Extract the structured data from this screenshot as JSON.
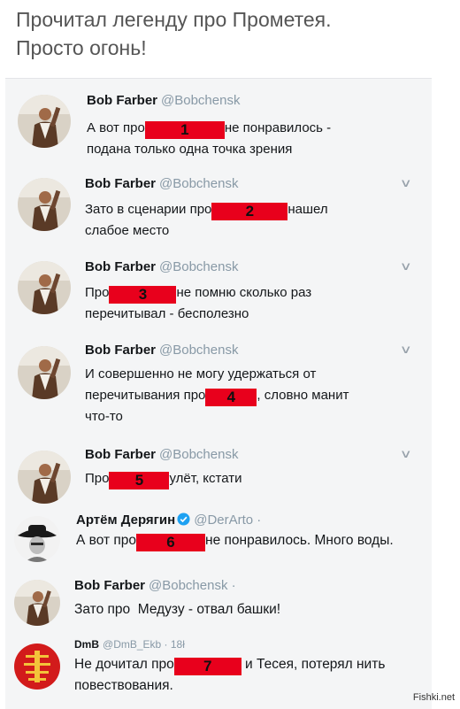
{
  "headline": {
    "line1": "Прочитал легенду про Прометея.",
    "line2": "Просто огонь!"
  },
  "tweets": [
    {
      "name": "Bob Farber",
      "handle": "@Bobchensk",
      "avatar_icon": "bob-farber-avatar",
      "before": "А вот про",
      "redaction": "1",
      "after": "не понравилось -",
      "line2": "подана только одна точка зрения"
    },
    {
      "name": "Bob Farber",
      "handle": "@Bobchensk",
      "avatar_icon": "bob-farber-avatar",
      "before": "Зато в сценарии про",
      "redaction": "2",
      "after": "нашел",
      "line2": "слабое место"
    },
    {
      "name": "Bob Farber",
      "handle": "@Bobchensk",
      "avatar_icon": "bob-farber-avatar",
      "before": "Про",
      "redaction": "3",
      "after": "не помню сколько раз",
      "line2": "перечитывал - бесполезно"
    },
    {
      "name": "Bob Farber",
      "handle": "@Bobchensk",
      "avatar_icon": "bob-farber-avatar",
      "line1": "И совершенно не могу удержаться от",
      "before": "перечитывания про",
      "redaction": "4",
      "after": ", словно манит",
      "line3": "что-то"
    },
    {
      "name": "Bob Farber",
      "handle": "@Bobchensk",
      "avatar_icon": "bob-farber-avatar",
      "before": "Про",
      "redaction": "5",
      "after": "улёт, кстати"
    },
    {
      "name": "Артём Дерягин",
      "handle": "@DerArto ·",
      "avatar_icon": "cowboy-avatar",
      "verified_icon": "verified-badge-icon",
      "before": "А вот про",
      "redaction": "6",
      "after": "не понравилось. Много воды."
    },
    {
      "name": "Bob Farber",
      "handle": "@Bobchensk ·",
      "avatar_icon": "bob-farber-avatar",
      "text": "Зато про  Медузу - отвал башки!"
    },
    {
      "name": "DmB",
      "handle": "@DmB_Ekb · 18ł",
      "avatar_icon": "red-emblem-avatar",
      "before": "Не дочитал про",
      "redaction": "7",
      "after": "и Тесея, потерял нить",
      "line2": "повествования."
    }
  ],
  "watermark": "Fishki.net",
  "colors": {
    "redaction": "#e8001c",
    "handle": "#8899a6",
    "verified": "#1da1f2",
    "panel_bg": "#f4f5f6"
  }
}
